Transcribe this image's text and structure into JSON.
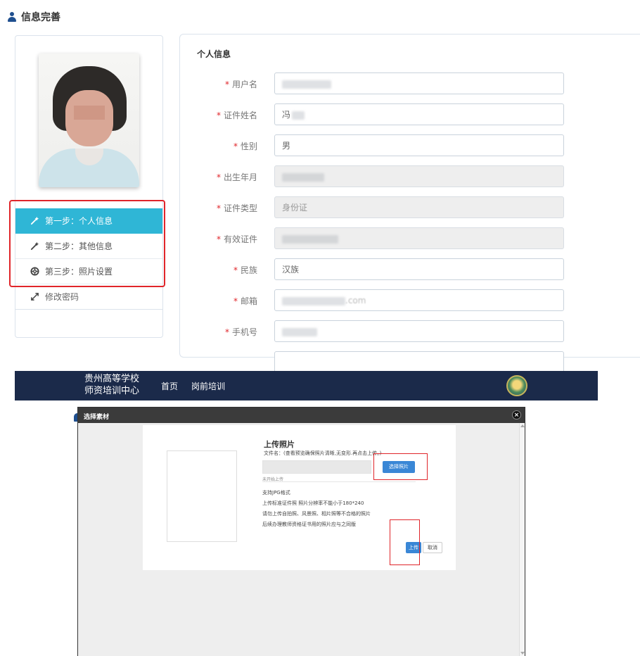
{
  "top": {
    "page_title": "信息完善",
    "steps": [
      {
        "label": "第一步：个人信息",
        "active": true,
        "icon": "magic-wand-icon"
      },
      {
        "label": "第二步：其他信息",
        "active": false,
        "icon": "magic-wand-icon"
      },
      {
        "label": "第三步：照片设置",
        "active": false,
        "icon": "lifebuoy-icon"
      }
    ],
    "change_password": {
      "label": "修改密码",
      "icon": "arrows-icon"
    },
    "section_title": "个人信息",
    "fields": [
      {
        "label": "用户名",
        "value": "",
        "readonly": false
      },
      {
        "label": "证件姓名",
        "value": "冯",
        "readonly": false
      },
      {
        "label": "性别",
        "value": "男",
        "readonly": false
      },
      {
        "label": "出生年月",
        "value": "",
        "readonly": true
      },
      {
        "label": "证件类型",
        "value": "身份证",
        "readonly": true
      },
      {
        "label": "有效证件",
        "value": "",
        "readonly": true
      },
      {
        "label": "民族",
        "value": "汉族",
        "readonly": false
      },
      {
        "label": "邮箱",
        "value": ".com",
        "readonly": false
      },
      {
        "label": "手机号",
        "value": "",
        "readonly": false
      }
    ],
    "required_mark": "*"
  },
  "bottom": {
    "brand_line1": "贵州高等学校",
    "brand_line2": "师资培训中心",
    "nav_home": "首页",
    "nav_training": "岗前培训",
    "modal_title": "选择素材",
    "modal_close": "×",
    "upload_title": "上传照片",
    "file_label": "文件名：(查看预览确保照片清晰,无变形.再点击上传。)",
    "choose_button": "选择照片",
    "status": "未开始上传",
    "requirements": [
      "支持JPG格式",
      "上传标准证件照 照片分辨率不能小于180*240",
      "请勿上传自拍照、风景照、相片照等不合格的照片",
      "后续办理教师资格证书用的照片应与之同版"
    ],
    "upload_button": "上传",
    "cancel_button": "取消"
  },
  "colors": {
    "accent_active": "#2fb6d6",
    "navbar": "#1b2a4a",
    "primary_button": "#3a87d6",
    "highlight_red": "#e0252a"
  }
}
